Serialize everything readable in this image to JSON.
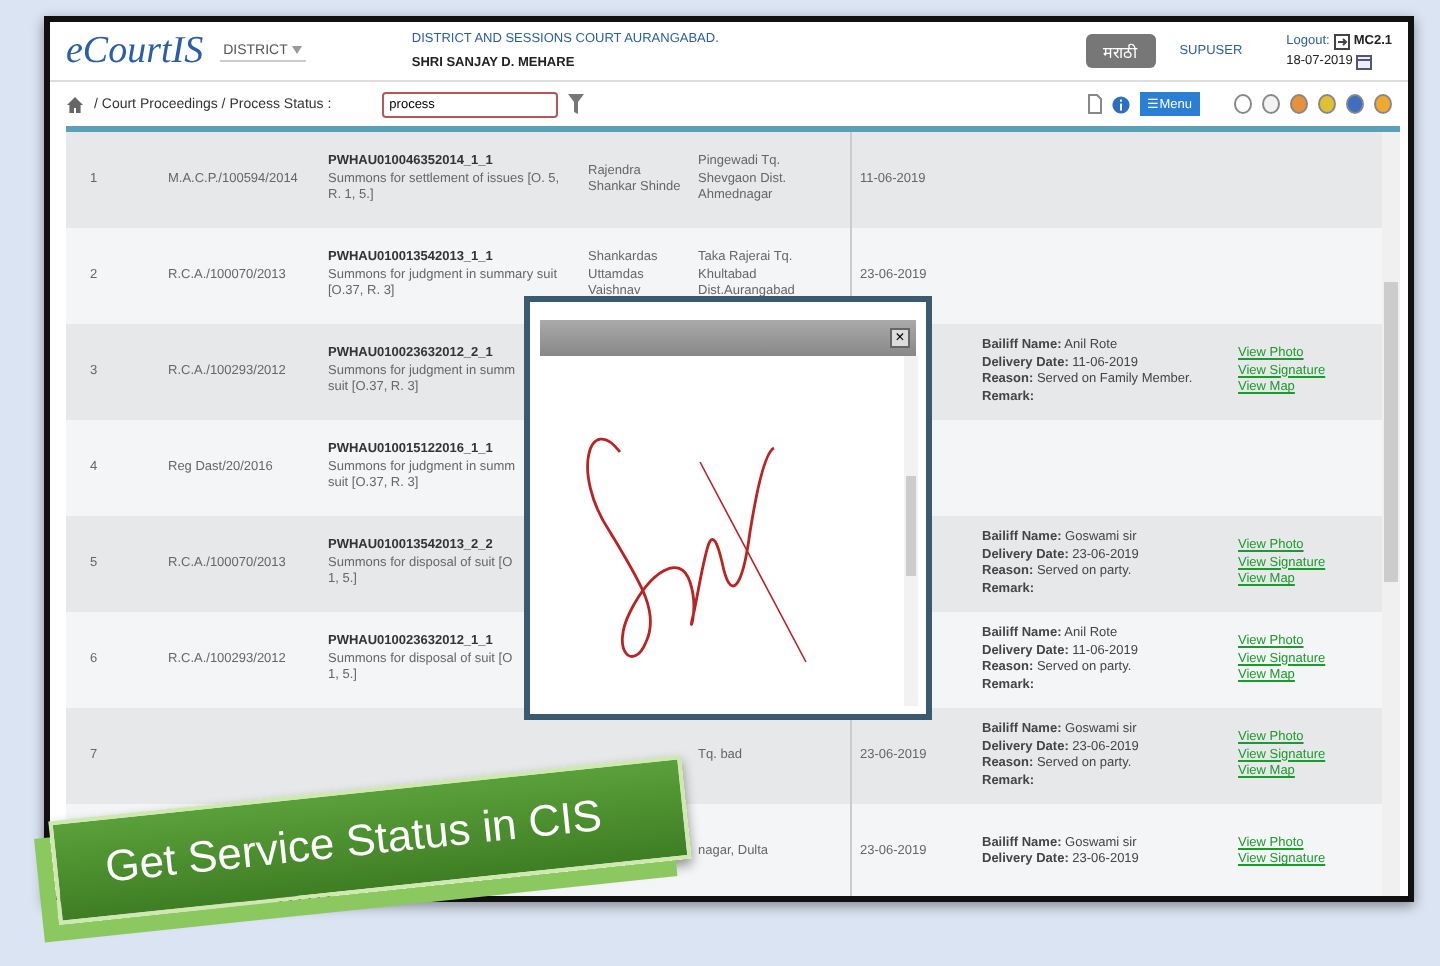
{
  "header": {
    "logo": "eCourtIS",
    "district_select": "DISTRICT",
    "court": "DISTRICT AND SESSIONS COURT AURANGABAD.",
    "user": "SHRI SANJAY D. MEHARE",
    "language_button": "मराठी",
    "role": "SUPUSER",
    "logout": "Logout:",
    "version": "MC2.1",
    "date": "18-07-2019"
  },
  "breadcrumb": {
    "path": "/ Court Proceedings / Process Status :",
    "search_value": "process",
    "menu_button": "☰Menu"
  },
  "theme_dots": [
    {
      "color": "#ffffff"
    },
    {
      "color": "#f2f2f2"
    },
    {
      "color": "#e8903a"
    },
    {
      "color": "#e0c030"
    },
    {
      "color": "#3f6fc0"
    },
    {
      "color": "#f0a830"
    }
  ],
  "rows": [
    {
      "num": "1",
      "case": "M.A.C.P./100594/2014",
      "process_id": "PWHAU010046352014_1_1",
      "process_desc": "Summons for settlement of issues [O. 5, R. 1, 5.]",
      "party": "Rajendra Shankar Shinde",
      "address": "Pingewadi Tq. Shevgaon Dist. Ahmednagar",
      "date": "11-06-2019"
    },
    {
      "num": "2",
      "case": "R.C.A./100070/2013",
      "process_id": "PWHAU010013542013_1_1",
      "process_desc": "Summons for judgment in summary suit [O.37, R. 3]",
      "party": "Shankardas Uttamdas Vaishnav",
      "address": "Taka Rajerai Tq. Khultabad Dist.Aurangabad",
      "date": "23-06-2019"
    },
    {
      "num": "3",
      "case": "R.C.A./100293/2012",
      "process_id": "PWHAU010023632012_2_1",
      "process_desc": "Summons for judgment in summ",
      "process_desc_2": "suit [O.37, R. 3]",
      "details": [
        "**Bailiff Name:** Anil Rote",
        "**Delivery Date:** 11-06-2019",
        "**Reason:** Served on Family Member.",
        "**Remark:**"
      ],
      "links": [
        "View Photo",
        "View Signature",
        "View Map"
      ]
    },
    {
      "num": "4",
      "case": "Reg Dast/20/2016",
      "process_id": "PWHAU010015122016_1_1",
      "process_desc": "Summons for judgment in summ",
      "process_desc_2": "suit [O.37, R. 3]"
    },
    {
      "num": "5",
      "case": "R.C.A./100070/2013",
      "process_id": "PWHAU010013542013_2_2",
      "process_desc": "Summons for disposal of suit [O",
      "process_desc_2": "1, 5.]",
      "details": [
        "**Bailiff Name:** Goswami sir",
        "**Delivery Date:** 23-06-2019",
        "**Reason:** Served on party.",
        "**Remark:**"
      ],
      "links": [
        "View Photo",
        "View Signature",
        "View Map"
      ]
    },
    {
      "num": "6",
      "case": "R.C.A./100293/2012",
      "process_id": "PWHAU010023632012_1_1",
      "process_desc": "Summons for disposal of suit [O",
      "process_desc_2": "1, 5.]",
      "details": [
        "**Bailiff Name:** Anil Rote",
        "**Delivery Date:** 11-06-2019",
        "**Reason:** Served on party.",
        "**Remark:**"
      ],
      "links": [
        "View Photo",
        "View Signature",
        "View Map"
      ]
    },
    {
      "num": "7",
      "address": "Tq. bad",
      "date": "23-06-2019",
      "details": [
        "**Bailiff Name:** Goswami sir",
        "**Delivery Date:** 23-06-2019",
        "**Reason:** Served on party.",
        "**Remark:**"
      ],
      "links": [
        "View Photo",
        "View Signature",
        "View Map"
      ]
    },
    {
      "address": "nagar, Dulta",
      "date": "23-06-2019",
      "details": [
        "**Bailiff Name:** Goswami sir",
        "**Delivery Date:** 23-06-2019"
      ],
      "links": [
        "View Photo",
        "View Signature"
      ]
    }
  ],
  "modal": {
    "close": "×"
  },
  "banner": {
    "text": "Get Service Status in CIS"
  }
}
